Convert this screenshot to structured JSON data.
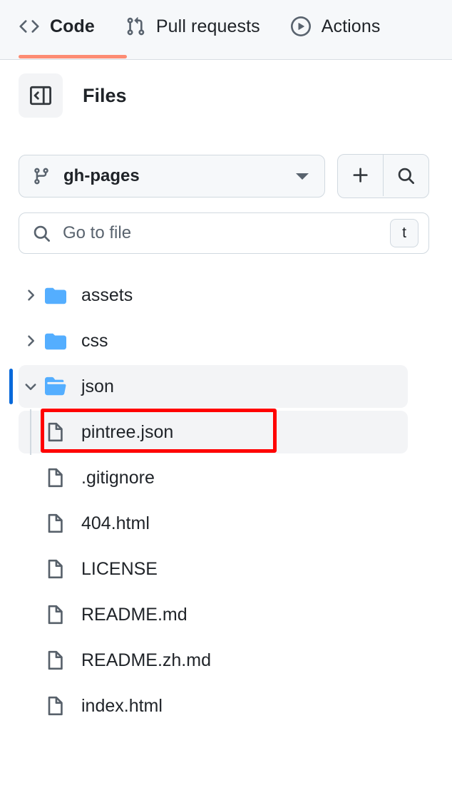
{
  "repo_nav": {
    "tabs": [
      {
        "label": "Code",
        "icon": "code-icon",
        "active": true
      },
      {
        "label": "Pull requests",
        "icon": "git-pull-request-icon",
        "active": false
      },
      {
        "label": "Actions",
        "icon": "play-circle-icon",
        "active": false
      }
    ],
    "active_tab_accent": "#fd8c73"
  },
  "files_panel": {
    "collapse_icon": "sidebar-collapse-icon",
    "title": "Files",
    "branch": {
      "icon": "git-branch-icon",
      "name": "gh-pages",
      "caret_icon": "chevron-down-icon"
    },
    "actions": [
      {
        "name": "add-file-button",
        "icon": "plus-icon"
      },
      {
        "name": "search-files-button",
        "icon": "search-icon"
      }
    ],
    "search": {
      "icon": "search-icon",
      "placeholder": "Go to file",
      "value": "",
      "shortcut": "t"
    }
  },
  "tree": {
    "nodes": [
      {
        "label": "assets",
        "type": "folder",
        "expanded": false,
        "chevron": "chevron-right-icon",
        "depth": 0,
        "selected": false
      },
      {
        "label": "css",
        "type": "folder",
        "expanded": false,
        "chevron": "chevron-right-icon",
        "depth": 0,
        "selected": false
      },
      {
        "label": "json",
        "type": "folder",
        "expanded": true,
        "chevron": "chevron-down-icon",
        "depth": 0,
        "selected": true
      },
      {
        "label": "pintree.json",
        "type": "file",
        "depth": 1,
        "selected": true,
        "annotated": true
      },
      {
        "label": ".gitignore",
        "type": "file",
        "depth": 0,
        "selected": false
      },
      {
        "label": "404.html",
        "type": "file",
        "depth": 0,
        "selected": false
      },
      {
        "label": "LICENSE",
        "type": "file",
        "depth": 0,
        "selected": false
      },
      {
        "label": "README.md",
        "type": "file",
        "depth": 0,
        "selected": false
      },
      {
        "label": "README.zh.md",
        "type": "file",
        "depth": 0,
        "selected": false
      },
      {
        "label": "index.html",
        "type": "file",
        "depth": 0,
        "selected": false
      }
    ],
    "active_indicator_color": "#0969da",
    "folder_color": "#54aeff",
    "selected_row_bg": "#f3f4f6"
  },
  "annotation": {
    "target": "pintree.json",
    "color": "#ff0000"
  }
}
